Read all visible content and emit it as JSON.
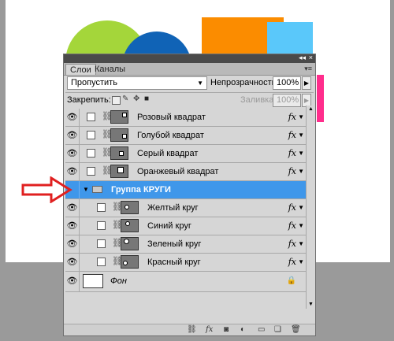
{
  "canvas": {
    "background": "#ffffff",
    "shapes": [
      {
        "name": "green-circle",
        "color": "#a4d63a"
      },
      {
        "name": "blue-circle",
        "color": "#1063b6"
      },
      {
        "name": "orange-square",
        "color": "#fb8c00"
      },
      {
        "name": "light-blue-square",
        "color": "#5ac8fa"
      },
      {
        "name": "pink-square",
        "color": "#ff2d8c"
      }
    ]
  },
  "panel": {
    "tabs": [
      {
        "label": "Слои",
        "active": true
      },
      {
        "label": "Каналы",
        "active": false
      }
    ],
    "blend_mode": "Пропустить",
    "opacity_label": "Непрозрачность:",
    "opacity_value": "100%",
    "lock_label": "Закрепить:",
    "fill_label": "Заливка:",
    "fill_value": "100%",
    "layers": [
      {
        "name": "Розовый квадрат",
        "fx": "fx",
        "visible": true
      },
      {
        "name": "Голубой квадрат",
        "fx": "fx",
        "visible": true
      },
      {
        "name": "Серый квадрат",
        "fx": "fx",
        "visible": true
      },
      {
        "name": "Оранжевый квадрат",
        "fx": "fx",
        "visible": true
      }
    ],
    "group": {
      "name": "Группа КРУГИ",
      "selected": true,
      "color": "#3f97ea"
    },
    "group_layers": [
      {
        "name": "Желтый круг",
        "fx": "fx",
        "visible": true
      },
      {
        "name": "Синий круг",
        "fx": "fx",
        "visible": true
      },
      {
        "name": "Зеленый круг",
        "fx": "fx",
        "visible": true
      },
      {
        "name": "Красный круг",
        "fx": "fx",
        "visible": true
      }
    ],
    "background_layer": {
      "name": "Фон",
      "locked": true
    }
  },
  "annotation_arrow_color": "#e02020"
}
